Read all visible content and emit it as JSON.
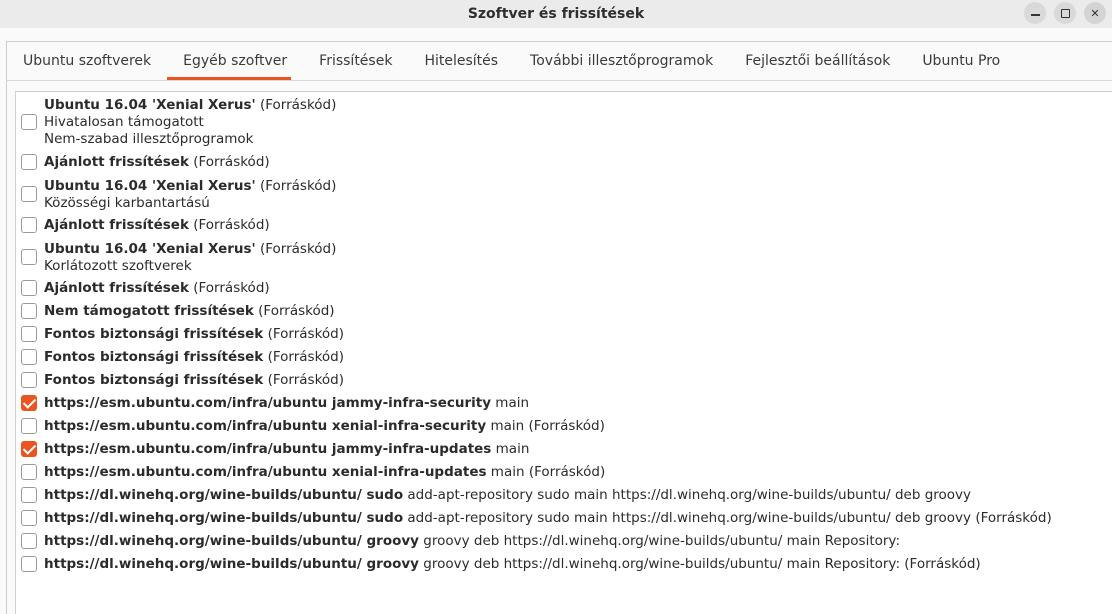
{
  "window": {
    "title": "Szoftver és frissítések",
    "controls": [
      "minimize-icon",
      "maximize-icon",
      "close-icon"
    ]
  },
  "tabs": [
    {
      "label": "Ubuntu szoftverek"
    },
    {
      "label": "Egyéb szoftver",
      "active": true
    },
    {
      "label": "Frissítések"
    },
    {
      "label": "Hitelesítés"
    },
    {
      "label": "További illesztőprogramok"
    },
    {
      "label": "Fejlesztői beállítások"
    },
    {
      "label": "Ubuntu Pro"
    }
  ],
  "accent_color": "#e95420",
  "sources": [
    {
      "checked": false,
      "bold": "Ubuntu 16.04 'Xenial Xerus'",
      "rest": " (Forráskód)",
      "line2": "Hivatalosan támogatott",
      "line3": "Nem-szabad illesztőprogramok"
    },
    {
      "checked": false,
      "bold": "Ajánlott frissítések",
      "rest": " (Forráskód)"
    },
    {
      "checked": false,
      "bold": "Ubuntu 16.04 'Xenial Xerus'",
      "rest": " (Forráskód)",
      "line2": "Közösségi karbantartású"
    },
    {
      "checked": false,
      "bold": "Ajánlott frissítések",
      "rest": " (Forráskód)"
    },
    {
      "checked": false,
      "bold": "Ubuntu 16.04 'Xenial Xerus'",
      "rest": " (Forráskód)",
      "line2": "Korlátozott szoftverek"
    },
    {
      "checked": false,
      "bold": "Ajánlott frissítések",
      "rest": " (Forráskód)"
    },
    {
      "checked": false,
      "bold": "Nem támogatott frissítések",
      "rest": " (Forráskód)"
    },
    {
      "checked": false,
      "bold": "Fontos biztonsági frissítések",
      "rest": " (Forráskód)"
    },
    {
      "checked": false,
      "bold": "Fontos biztonsági frissítések",
      "rest": " (Forráskód)"
    },
    {
      "checked": false,
      "bold": "Fontos biztonsági frissítések",
      "rest": " (Forráskód)"
    },
    {
      "checked": true,
      "bold": "https://esm.ubuntu.com/infra/ubuntu jammy-infra-security",
      "rest": " main"
    },
    {
      "checked": false,
      "bold": "https://esm.ubuntu.com/infra/ubuntu xenial-infra-security",
      "rest": " main (Forráskód)"
    },
    {
      "checked": true,
      "bold": "https://esm.ubuntu.com/infra/ubuntu jammy-infra-updates",
      "rest": " main"
    },
    {
      "checked": false,
      "bold": "https://esm.ubuntu.com/infra/ubuntu xenial-infra-updates",
      "rest": " main (Forráskód)"
    },
    {
      "checked": false,
      "bold": "https://dl.winehq.org/wine-builds/ubuntu/ sudo",
      "rest": " add-apt-repository sudo main https://dl.winehq.org/wine-builds/ubuntu/ deb groovy"
    },
    {
      "checked": false,
      "bold": "https://dl.winehq.org/wine-builds/ubuntu/ sudo",
      "rest": " add-apt-repository sudo main https://dl.winehq.org/wine-builds/ubuntu/ deb groovy (Forráskód)"
    },
    {
      "checked": false,
      "bold": "https://dl.winehq.org/wine-builds/ubuntu/ groovy",
      "rest": " groovy deb https://dl.winehq.org/wine-builds/ubuntu/ main Repository:"
    },
    {
      "checked": false,
      "bold": "https://dl.winehq.org/wine-builds/ubuntu/ groovy",
      "rest": " groovy deb https://dl.winehq.org/wine-builds/ubuntu/ main Repository: (Forráskód)"
    }
  ]
}
